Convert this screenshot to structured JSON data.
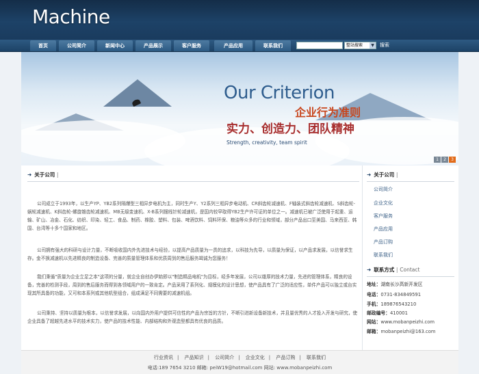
{
  "header": {
    "logo": "Machine"
  },
  "nav": {
    "items": [
      "首页",
      "公司简介",
      "新闻中心",
      "产品展示",
      "客户服务",
      "产品应用",
      "联系我们"
    ],
    "search_option": "整站搜索",
    "search_button": "搜索"
  },
  "banner": {
    "title_en": "Our Criterion",
    "title_cn": "企业行为准则",
    "slogan_cn": "实力、创造力、团队精神",
    "slogan_en": "Strength, creativity, team spirit",
    "slide_numbers": [
      "1",
      "2",
      "3"
    ],
    "active_slide": 3
  },
  "about": {
    "heading": "关于公司",
    "paragraphs": [
      "公司成立于1993年，以生产YP、YB2系列隔爆型三相异步电机为主，同时生产Y、Y2系列三相异步电动机、CR斜齿轮减速机、F轴装式斜齿轮减速机、S斜齿轮-蜗轮减速机、K斜齿轮-螺旋锥齿轮减速机、MB无级变速机、X-B系列摆线针轮减速机，是国内较早取得YB2生产许可证的单位之一。减速机已被广泛使用于起重、运输、矿山、冶金、石化、纺织、印染、轻工、食品、制药、橡胶、塑料、包装、啤酒饮料、饲料环保、粮油等众多的行业和领域，部分产品出口至美国、马来西亚、韩国、台湾等十多个国家和地区。",
      "公司拥有强大的科研与设计力量，不断吸收国内外先进技术与经验，以提高产品质量为一贯的追求，以科技为先导，以质量为保证，以产品求发展，以信誉求生存。金不换减速机以先进精良的制造设备、完善的质量管理体系和优质周到的售后服务竭诚为您服务！",
      "我们秉循\"质量为企业立足之本\"这项的分量，就企业自创办伊始即以\"制造精品电机\"为目标，经多年发展，公司以雄厚的技术力量，先进的管理体系，精良的设备，完善的检测手段，周到的售后服务而得到各领域用户的一致肯定。产品采用了系列化、规模化的设计思想，使产品具有了广泛的适应性，单件产品可以独立或台实现其所具备的功能，又可和本系列或其他机型组合，组成满足不同需要的减速机组。",
      "公司秉持、坚持以质量为根本，以信誉求发展，以向国内外用户提供可信性的产品为宗旨的方针，不断引进新设备新技术，并且量优秀的人才投入开发与研究，使企业具备了超越先进水平的技术实力，使产品的技术性能、内部结构和外观造型都具有优良的品质。"
    ]
  },
  "sidebar": {
    "heading": "关于公司",
    "links": [
      "公司简介",
      "企业文化",
      "客户服务",
      "产品应用",
      "产品订购",
      "联系我们"
    ]
  },
  "contact": {
    "heading": "联系方式",
    "heading_en": "Contact",
    "rows": [
      {
        "label": "地址：",
        "value": "湖南长沙高新开发区"
      },
      {
        "label": "电话：",
        "value": "0731-834849591"
      },
      {
        "label": "手机：",
        "value": "189876543210"
      },
      {
        "label": "邮政编号：",
        "value": "410001"
      },
      {
        "label": "网站：",
        "value": "www.mobanpeizhi.com"
      },
      {
        "label": "邮箱：",
        "value": "mobanpeizhi@163.com"
      }
    ]
  },
  "footer": {
    "links": [
      "行业资讯",
      "产品知识",
      "公司简介",
      "企业文化",
      "产品订购",
      "联系我们"
    ],
    "separator": "|",
    "info": "电话:189 7654 3210 邮箱: peiW19@hotmail.com 网站: www.mobanpeizhi.com"
  },
  "colors": {
    "header": "#1d4267",
    "nav": "#2c5a83",
    "active_slide": "#e26b1a",
    "link": "#3a5f86"
  }
}
